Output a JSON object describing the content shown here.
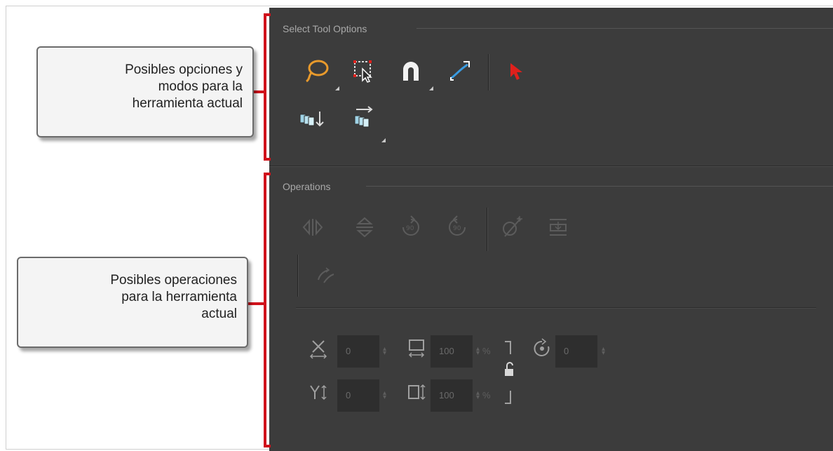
{
  "callouts": {
    "tool_options": [
      "Posibles opciones y",
      "modos para la",
      "herramienta actual"
    ],
    "operations": [
      "Posibles operaciones",
      "para la herramienta",
      "actual"
    ]
  },
  "sections": {
    "select_tool_options": "Select Tool Options",
    "operations": "Operations"
  },
  "tool_options_icons": [
    "lasso-icon",
    "marquee-select-icon",
    "snap-magnet-icon",
    "bend-edge-icon",
    "select-arrow-icon",
    "apply-to-all-frames-icon",
    "permanent-selection-icon"
  ],
  "operations_icons": [
    "flip-horizontal-icon",
    "flip-vertical-icon",
    "rotate-90-cw-icon",
    "rotate-90-ccw-icon",
    "smooth-icon",
    "flatten-icon",
    "create-empty-drawing-icon"
  ],
  "transform_fields": {
    "x_value": "0",
    "y_value": "0",
    "width_value": "100",
    "height_value": "100",
    "angle_value": "0",
    "percent_symbol": "%"
  },
  "colors": {
    "panel_bg": "#3c3c3c",
    "field_bg": "#2e2e2e",
    "bracket": "#d0121b",
    "lasso_orange": "#e89a2c",
    "arrow_red": "#e0201c",
    "bend_blue": "#3a9be0"
  }
}
